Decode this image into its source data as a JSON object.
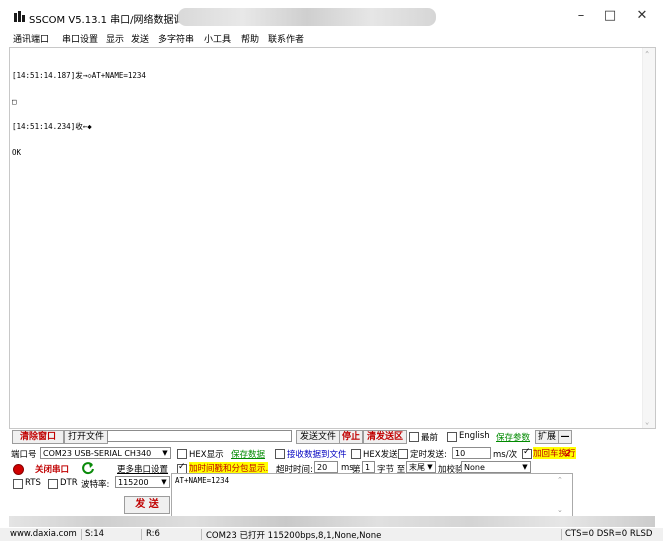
{
  "window": {
    "title": "SSCOM V5.13.1 串口/网络数据调试器,"
  },
  "menu": [
    "通讯端口",
    "串口设置",
    "显示",
    "发送",
    "多字符串",
    "小工具",
    "帮助",
    "联系作者"
  ],
  "receive": {
    "lines": [
      "[14:51:14.187]发→◇AT+NAME=1234",
      "□",
      "[14:51:14.234]收←◆",
      "OK"
    ]
  },
  "toolbar1": {
    "clear_window": "清除窗口",
    "open_file": "打开文件",
    "send_file": "发送文件",
    "stop": "停止",
    "clear_send": "清发送区",
    "topmost": "最前",
    "english": "English",
    "save_params": "保存参数",
    "expand": "扩展",
    "minus": "—"
  },
  "toolbar2": {
    "port_label": "端口号",
    "port_value": "COM23 USB-SERIAL CH340",
    "hex_display": "HEX显示",
    "save_data": "保存数据",
    "recv_to_file": "接收数据到文件",
    "hex_send": "HEX发送",
    "timed_send": "定时发送:",
    "interval_value": "10",
    "interval_unit": "ms/次",
    "add_crlf": "加回车换行",
    "red_mark": "2"
  },
  "toolbar3": {
    "close_port": "关闭串口",
    "more_settings": "更多串口设置",
    "timestamp_split": "加时间戳和分包显示.",
    "timeout_label": "超时时间:",
    "timeout_value": "20",
    "timeout_unit": "ms",
    "byte_label_1": "第",
    "byte_from": "1",
    "byte_label_2": "字节 至",
    "byte_to": "末尾",
    "checksum_label": "加校验",
    "checksum_value": "None"
  },
  "toolbar4": {
    "rts": "RTS",
    "dtr": "DTR",
    "baud_label": "波特率:",
    "baud_value": "115200",
    "send_button": "发 送"
  },
  "send_text": "AT+NAME=1234",
  "status": {
    "website": "www.daxia.com",
    "s_count": "S:14",
    "r_count": "R:6",
    "port_status": "COM23 已打开  115200bps,8,1,None,None",
    "signals": "CTS=0 DSR=0 RLSD"
  },
  "colors": {
    "accent_red": "#c00000",
    "accent_green": "#008a00",
    "highlight_yellow": "#ffff00"
  }
}
